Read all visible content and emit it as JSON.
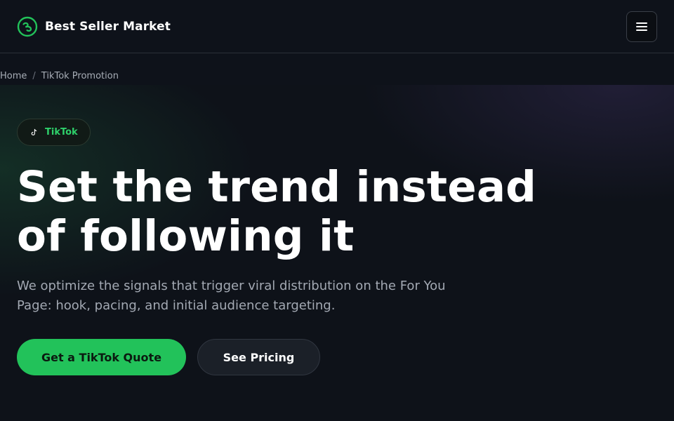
{
  "header": {
    "brand_name": "Best Seller Market",
    "logo_icon": "circle-logo-icon",
    "menu_icon": "hamburger-menu-icon"
  },
  "breadcrumb": {
    "items": [
      "Home",
      "TikTok Promotion"
    ],
    "separator": "/"
  },
  "hero": {
    "badge_icon": "tiktok-note-icon",
    "badge_label": "TikTok",
    "title": "Set the trend instead of following it",
    "subtitle": "We optimize the signals that trigger viral distribution on the For You Page: hook, pacing, and initial audience targeting.",
    "primary_cta": "Get a TikTok Quote",
    "secondary_cta": "See Pricing"
  },
  "colors": {
    "accent": "#22c25a",
    "background": "#0e1219",
    "text_muted": "#a3a9b3"
  }
}
